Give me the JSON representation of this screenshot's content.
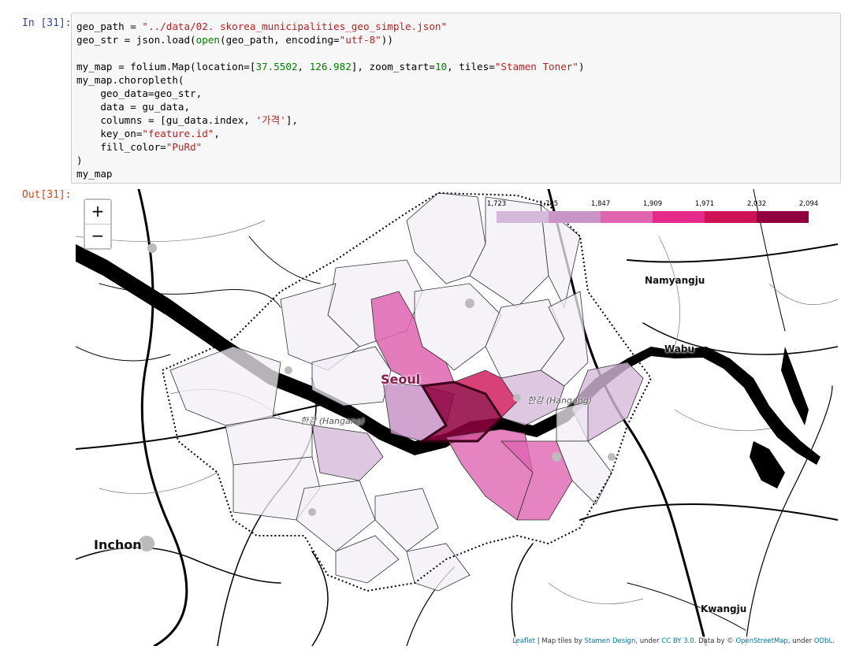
{
  "input_prompt": "In [31]:",
  "output_prompt": "Out[31]:",
  "code": {
    "l1a": "geo_path = ",
    "l1b": "\"../data/02. skorea_municipalities_geo_simple.json\"",
    "l2a": "geo_str = json.load(",
    "l2b": "open",
    "l2c": "(geo_path, encoding=",
    "l2d": "\"utf-8\"",
    "l2e": "))",
    "l3a": "my_map = folium.Map(location=[",
    "l3b": "37.5502",
    "l3c": ", ",
    "l3d": "126.982",
    "l3e": "], zoom_start=",
    "l3f": "10",
    "l3g": ", tiles=",
    "l3h": "\"Stamen Toner\"",
    "l3i": ")",
    "l4": "my_map.choropleth(",
    "l5": "    geo_data=geo_str,",
    "l6": "    data = gu_data,",
    "l7a": "    columns = [gu_data.index, ",
    "l7b": "'가격'",
    "l7c": "],",
    "l8a": "    key_on=",
    "l8b": "\"feature.id\"",
    "l8c": ",",
    "l9a": "    fill_color=",
    "l9b": "\"PuRd\"",
    "l10": ")",
    "l11": "my_map"
  },
  "map": {
    "zoom_in": "+",
    "zoom_out": "−",
    "legend": {
      "ticks": [
        "1,723",
        "1,785",
        "1,847",
        "1,909",
        "1,971",
        "2,032",
        "2,094"
      ],
      "colors": [
        "#f1eef6",
        "#d4b9da",
        "#c994c7",
        "#df65b0",
        "#e7298a",
        "#ce1256",
        "#91003f"
      ]
    },
    "places": {
      "seoul": "Seoul",
      "namyangju": "Namyangju",
      "wabu": "Wabu",
      "inchon": "Inchon",
      "kwangju": "Kwangju",
      "river_left": "한강 (Hangang)",
      "river_right": "한강 (Hangang)"
    },
    "attribution": {
      "leaflet": "Leaflet",
      "t1": " | Map tiles by ",
      "stamen": "Stamen Design",
      "t2": ", under ",
      "cc": "CC BY 3.0",
      "t3": ". Data by © ",
      "osm": "OpenStreetMap",
      "t4": ", under ",
      "odbl": "ODbL",
      "t5": "."
    }
  }
}
